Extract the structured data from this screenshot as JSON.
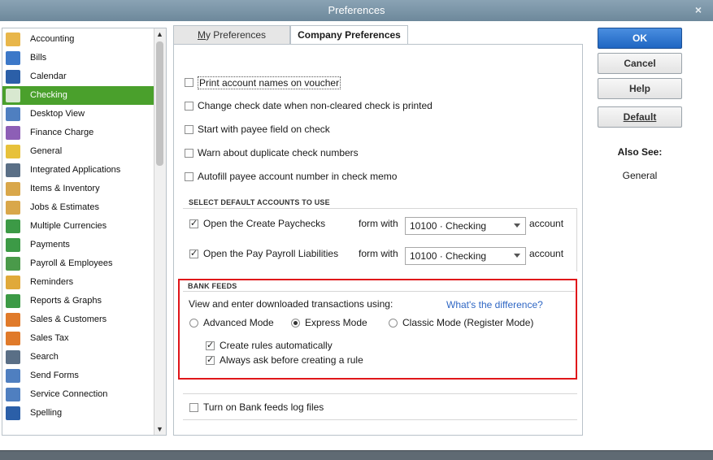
{
  "window": {
    "title": "Preferences",
    "close_glyph": "×"
  },
  "sidebar": {
    "items": [
      {
        "label": "Accounting",
        "icon": "accounting-icon",
        "color": "#e8b64a"
      },
      {
        "label": "Bills",
        "icon": "bills-icon",
        "color": "#3c78c8"
      },
      {
        "label": "Calendar",
        "icon": "calendar-icon",
        "color": "#2b5fa8"
      },
      {
        "label": "Checking",
        "icon": "checking-icon",
        "color": "#d8e8d0",
        "active": true
      },
      {
        "label": "Desktop View",
        "icon": "desktop-view-icon",
        "color": "#4f7fc0"
      },
      {
        "label": "Finance Charge",
        "icon": "finance-charge-icon",
        "color": "#8d5fb6"
      },
      {
        "label": "General",
        "icon": "general-icon",
        "color": "#e7c13a"
      },
      {
        "label": "Integrated Applications",
        "icon": "integrated-applications-icon",
        "color": "#5a6f86"
      },
      {
        "label": "Items & Inventory",
        "icon": "items-inventory-icon",
        "color": "#d9a74a"
      },
      {
        "label": "Jobs & Estimates",
        "icon": "jobs-estimates-icon",
        "color": "#d9a74a"
      },
      {
        "label": "Multiple Currencies",
        "icon": "multiple-currencies-icon",
        "color": "#3c9a46"
      },
      {
        "label": "Payments",
        "icon": "payments-icon",
        "color": "#3c9a46"
      },
      {
        "label": "Payroll & Employees",
        "icon": "payroll-employees-icon",
        "color": "#4a9a4a"
      },
      {
        "label": "Reminders",
        "icon": "reminders-icon",
        "color": "#e0a93a"
      },
      {
        "label": "Reports & Graphs",
        "icon": "reports-graphs-icon",
        "color": "#3c9a46"
      },
      {
        "label": "Sales & Customers",
        "icon": "sales-customers-icon",
        "color": "#e07a2a"
      },
      {
        "label": "Sales Tax",
        "icon": "sales-tax-icon",
        "color": "#e07a2a"
      },
      {
        "label": "Search",
        "icon": "search-icon",
        "color": "#5a6f86"
      },
      {
        "label": "Send Forms",
        "icon": "send-forms-icon",
        "color": "#4f7fc0"
      },
      {
        "label": "Service Connection",
        "icon": "service-connection-icon",
        "color": "#4f7fc0"
      },
      {
        "label": "Spelling",
        "icon": "spelling-icon",
        "color": "#2b5fa8"
      }
    ]
  },
  "tabs": {
    "my_prefix": "M",
    "my_rest": "y Preferences",
    "company": "Company Preferences"
  },
  "options": [
    {
      "label": "Print account names on voucher",
      "checked": false
    },
    {
      "label": "Change check date when non-cleared check is printed",
      "checked": false
    },
    {
      "label": "Start with payee field on check",
      "checked": false
    },
    {
      "label": "Warn about duplicate check numbers",
      "checked": false
    },
    {
      "label": "Autofill payee account number in check memo",
      "checked": false
    }
  ],
  "default_accounts": {
    "heading": "SELECT DEFAULT ACCOUNTS TO USE",
    "rows": [
      {
        "label": "Open the Create Paychecks",
        "checked": true,
        "form_with": "form with",
        "account": "10100 · Checking",
        "suffix": "account"
      },
      {
        "label": "Open the Pay Payroll Liabilities",
        "checked": true,
        "form_with": "form with",
        "account": "10100 · Checking",
        "suffix": "account"
      }
    ]
  },
  "bank_feeds": {
    "heading": "BANK FEEDS",
    "prompt": "View and enter downloaded transactions using:",
    "link": "What's the difference?",
    "modes": [
      {
        "label": "Advanced Mode",
        "selected": false
      },
      {
        "label": "Express Mode",
        "selected": true
      },
      {
        "label": "Classic Mode (Register Mode)",
        "selected": false
      }
    ],
    "sub_options": [
      {
        "label": "Create rules automatically",
        "checked": true
      },
      {
        "label": "Always ask before creating a rule",
        "checked": true
      }
    ],
    "highlight_color": "#e0161a"
  },
  "log_option": {
    "label": "Turn on Bank feeds log files",
    "checked": false
  },
  "buttons": {
    "ok": "OK",
    "cancel": "Cancel",
    "help": "Help",
    "default": "Default"
  },
  "also_see": {
    "heading": "Also See:",
    "item": "General"
  },
  "colors": {
    "accent": "#1f66c2",
    "active_item": "#4aa02c"
  }
}
